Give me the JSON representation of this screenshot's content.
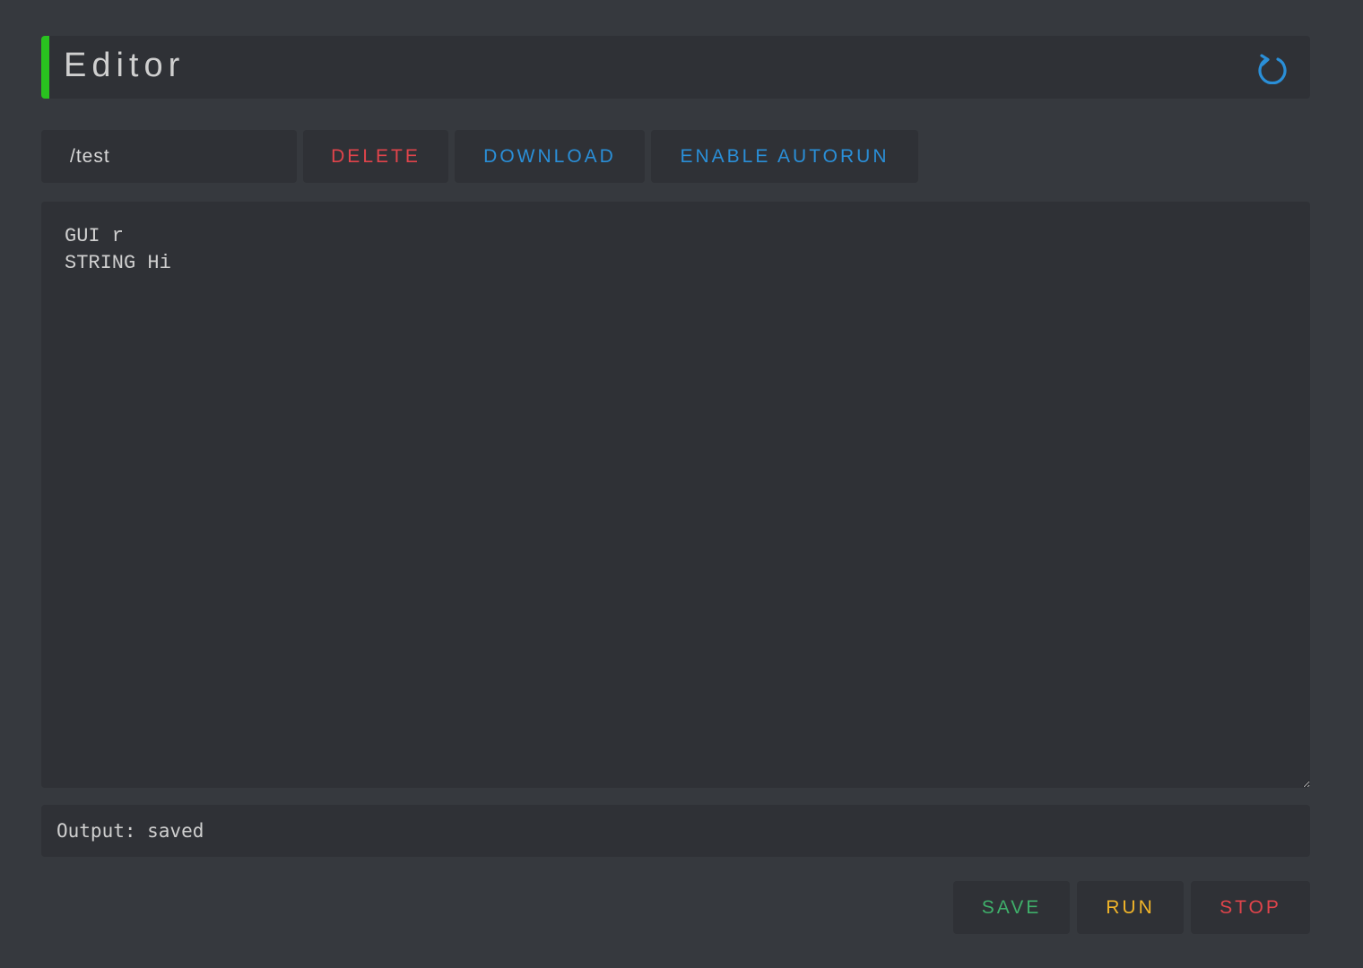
{
  "header": {
    "title": "Editor",
    "accent_color": "#29c21f",
    "reload_icon": "reload-icon"
  },
  "toolbar": {
    "filename_value": "/test",
    "delete_label": "DELETE",
    "download_label": "DOWNLOAD",
    "autorun_label": "ENABLE AUTORUN"
  },
  "editor": {
    "content": "GUI r\nSTRING Hi"
  },
  "output": {
    "text": "Output: saved"
  },
  "actions": {
    "save_label": "SAVE",
    "run_label": "RUN",
    "stop_label": "STOP"
  },
  "colors": {
    "background": "#36393e",
    "panel": "#2f3136",
    "danger": "#e0444b",
    "info": "#2a8fd8",
    "success": "#3faf6a",
    "warning": "#f0b429"
  }
}
